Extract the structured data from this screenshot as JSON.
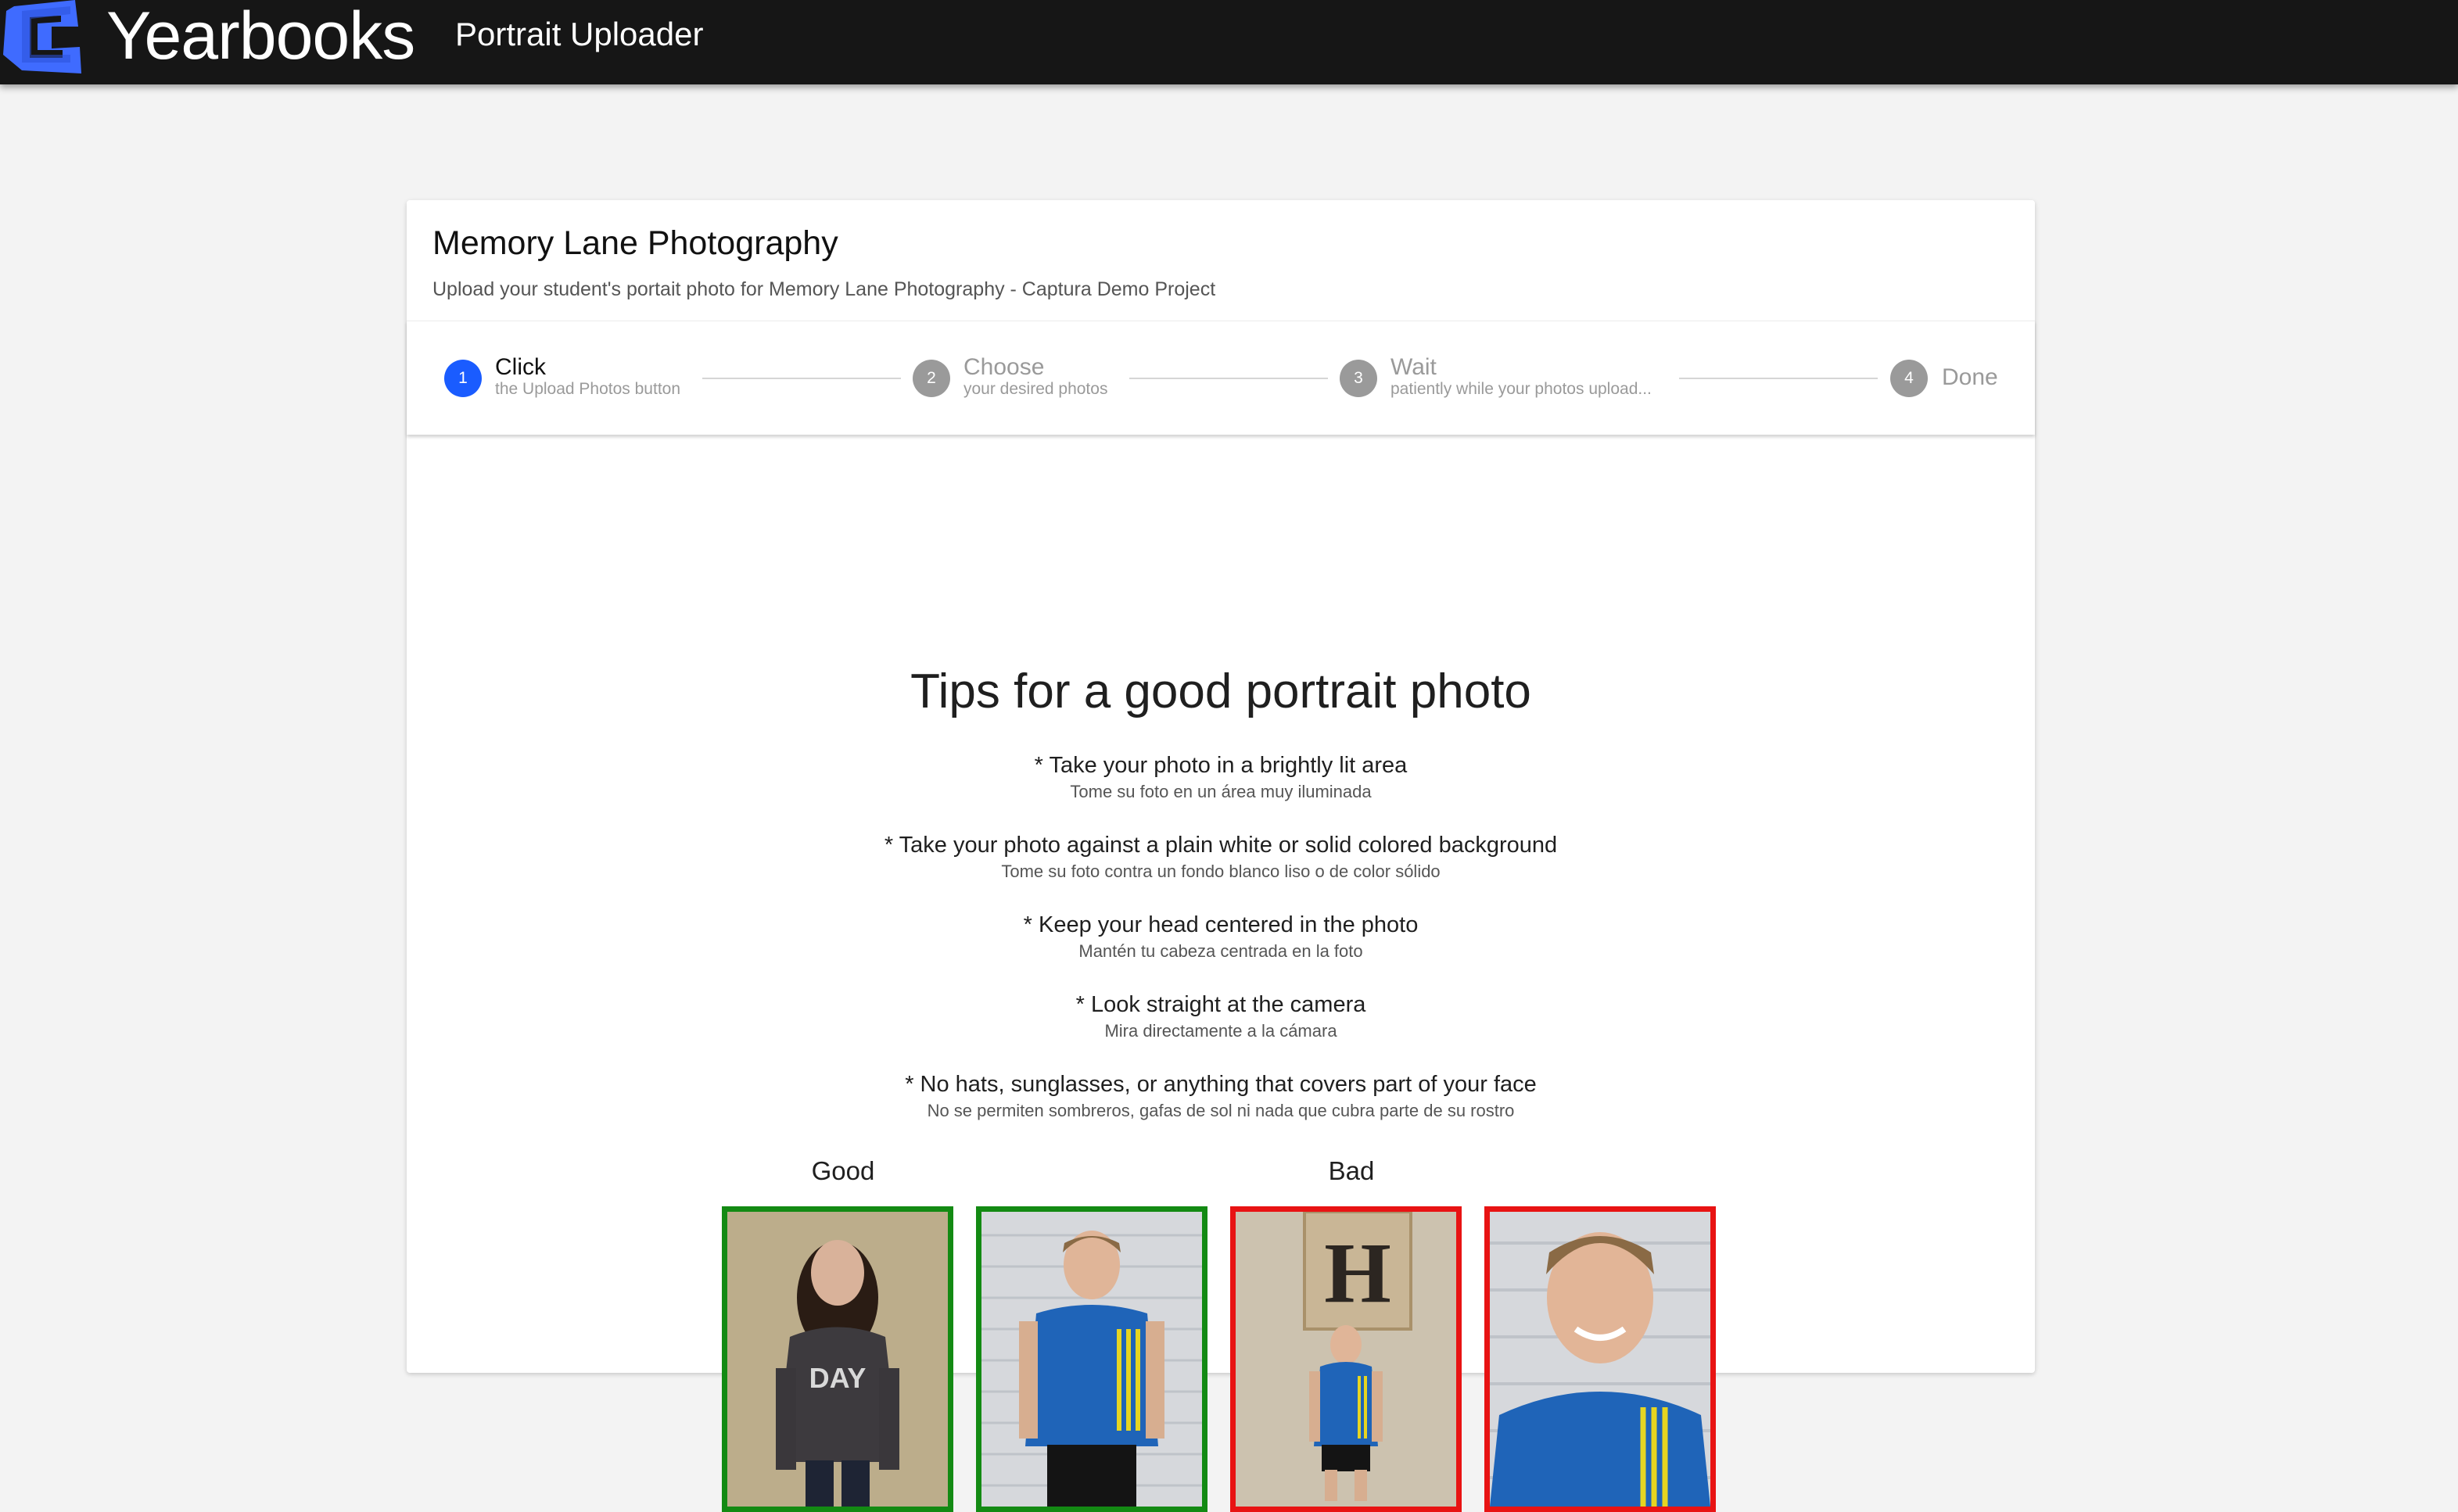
{
  "app": {
    "brand": "Yearbooks",
    "subtitle": "Portrait Uploader",
    "logo_icon": "yearbooks-logo-icon",
    "bar_color": "#161616",
    "accent_color": "#3f6bff"
  },
  "card": {
    "title": "Memory Lane Photography",
    "description": "Upload your student's portait photo for Memory Lane Photography - Captura Demo Project"
  },
  "stepper": {
    "active_step": 1,
    "steps": [
      {
        "number": "1",
        "label": "Click",
        "sub": "the Upload Photos button"
      },
      {
        "number": "2",
        "label": "Choose",
        "sub": "your desired photos"
      },
      {
        "number": "3",
        "label": "Wait",
        "sub": "patiently while your photos upload..."
      },
      {
        "number": "4",
        "label": "Done",
        "sub": ""
      }
    ],
    "active_color": "#1a5cff",
    "inactive_color": "#9a9a9a"
  },
  "tips": {
    "title": "Tips for a good portrait photo",
    "items": [
      {
        "en": "* Take your photo in a brightly lit area",
        "es": "Tome su foto en un área muy iluminada"
      },
      {
        "en": "* Take your photo against a plain white or solid colored background",
        "es": "Tome su foto contra un fondo blanco liso o de color sólido"
      },
      {
        "en": "* Keep your head centered in the photo",
        "es": "Mantén tu cabeza centrada en la foto"
      },
      {
        "en": "* Look straight at the camera",
        "es": "Mira directamente a la cámara"
      },
      {
        "en": "* No hats, sunglasses, or anything that covers part of your face",
        "es": "No se permiten sombreros, gafas de sol ni nada que cubra parte de su rostro"
      }
    ]
  },
  "examples": {
    "good_label": "Good",
    "bad_label": "Bad",
    "good_color": "#138a13",
    "bad_color": "#e81313",
    "photos": [
      {
        "kind": "good",
        "subject": "girl in dark hoodie against beige wall"
      },
      {
        "kind": "good",
        "subject": "boy in blue shirt against white siding"
      },
      {
        "kind": "bad",
        "subject": "boy standing too far away under letter H sign"
      },
      {
        "kind": "bad",
        "subject": "boy too close, face cropped"
      }
    ],
    "sign_letter": "H",
    "hoodie_text": "DAY"
  }
}
